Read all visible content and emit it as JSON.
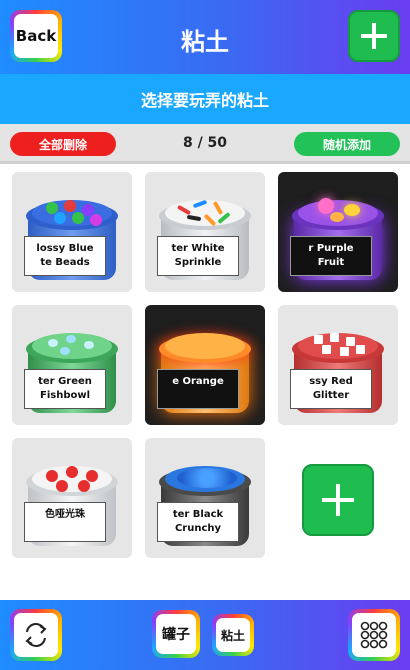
{
  "header": {
    "back_label": "Back",
    "title": "粘土"
  },
  "subtitle": "选择要玩弄的粘土",
  "actions": {
    "delete_all": "全部删除",
    "counter": "8 / 50",
    "random_add": "随机添加"
  },
  "slimes": [
    {
      "line1": "lossy Blue",
      "line2": "te Beads",
      "jar_color": "#3d6fd6",
      "top_color": "#3a6ee0",
      "dark": false
    },
    {
      "line1": "ter White",
      "line2": "Sprinkle",
      "jar_color": "#cfd3d8",
      "top_color": "#f2f2f2",
      "dark": false
    },
    {
      "line1": "r Purple",
      "line2": "Fruit",
      "jar_color": "#7a3fd0",
      "top_color": "#9a52e8",
      "dark": true
    },
    {
      "line1": "ter Green",
      "line2": "Fishbowl",
      "jar_color": "#3ea65a",
      "top_color": "#6fd48a",
      "dark": false
    },
    {
      "line1": "e Orange",
      "line2": "",
      "jar_color": "#ff9a2a",
      "top_color": "#ffb347",
      "dark": true
    },
    {
      "line1": "ssy Red",
      "line2": "Glitter",
      "jar_color": "#d94040",
      "top_color": "#e04b4b",
      "dark": false
    },
    {
      "line1": "",
      "line2": "色哑光珠",
      "jar_color": "#d8d8d8",
      "top_color": "#f4f4f4",
      "dark": false
    },
    {
      "line1": "ter Black",
      "line2": "Crunchy",
      "jar_color": "#555555",
      "top_color": "#2a77e0",
      "dark": false
    }
  ],
  "bottom": {
    "jar_label": "罐子",
    "slime_label": "粘土",
    "refresh_icon": "refresh-icon",
    "grid_icon": "grid-dots-icon"
  },
  "colors": {
    "add_green": "#1fbd4f",
    "delete_red": "#ee1f1f",
    "subbar_blue": "#1aa7ff"
  }
}
